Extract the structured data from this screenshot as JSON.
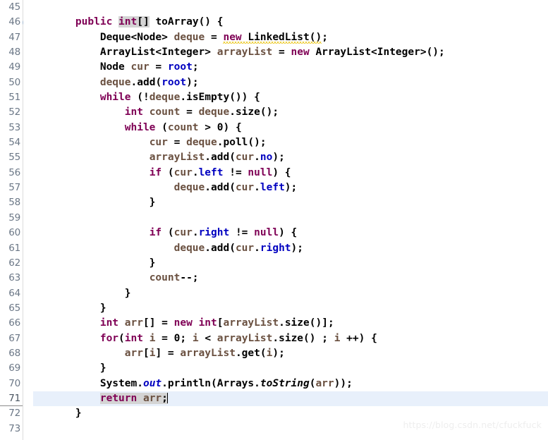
{
  "editor": {
    "language": "Java",
    "first_line": 45,
    "last_line": 73,
    "current_line": 71,
    "fold_marker_line": 46,
    "gutter": {
      "line_numbers": [
        "45",
        "46",
        "47",
        "48",
        "49",
        "50",
        "51",
        "52",
        "53",
        "54",
        "55",
        "56",
        "57",
        "58",
        "59",
        "60",
        "61",
        "62",
        "63",
        "64",
        "65",
        "66",
        "67",
        "68",
        "69",
        "70",
        "71",
        "72",
        "73"
      ],
      "fold_icon": "collapse-minus-icon"
    },
    "colors": {
      "background": "#ffffff",
      "keyword": "#7f0055",
      "field": "#0000c0",
      "local_variable": "#6a5040",
      "plain_text": "#000000",
      "line_number": "#6b7786",
      "current_line_highlight": "#e8f0fb",
      "occurrence_highlight": "#d4d4d4",
      "warning_squiggle": "#e8c000",
      "gutter_border": "#dcdcdc",
      "watermark": "#eeeeee"
    },
    "lines": [
      {
        "n": "45",
        "text": ""
      },
      {
        "n": "46",
        "text": "    public int[] toArray() {"
      },
      {
        "n": "47",
        "text": "        Deque<Node> deque = new LinkedList();"
      },
      {
        "n": "48",
        "text": "        ArrayList<Integer> arrayList = new ArrayList<Integer>();"
      },
      {
        "n": "49",
        "text": "        Node cur = root;"
      },
      {
        "n": "50",
        "text": "        deque.add(root);"
      },
      {
        "n": "51",
        "text": "        while (!deque.isEmpty()) {"
      },
      {
        "n": "52",
        "text": "            int count = deque.size();"
      },
      {
        "n": "53",
        "text": "            while (count > 0) {"
      },
      {
        "n": "54",
        "text": "                cur = deque.poll();"
      },
      {
        "n": "55",
        "text": "                arrayList.add(cur.no);"
      },
      {
        "n": "56",
        "text": "                if (cur.left != null) {"
      },
      {
        "n": "57",
        "text": "                    deque.add(cur.left);"
      },
      {
        "n": "58",
        "text": "                }"
      },
      {
        "n": "59",
        "text": ""
      },
      {
        "n": "60",
        "text": "                if (cur.right != null) {"
      },
      {
        "n": "61",
        "text": "                    deque.add(cur.right);"
      },
      {
        "n": "62",
        "text": "                }"
      },
      {
        "n": "63",
        "text": "                count--;"
      },
      {
        "n": "64",
        "text": "            }"
      },
      {
        "n": "65",
        "text": "        }"
      },
      {
        "n": "66",
        "text": "        int arr[] = new int[arrayList.size()];"
      },
      {
        "n": "67",
        "text": "        for(int i = 0; i < arrayList.size() ; i ++) {"
      },
      {
        "n": "68",
        "text": "            arr[i] = arrayList.get(i);"
      },
      {
        "n": "69",
        "text": "        }"
      },
      {
        "n": "70",
        "text": "        System.out.println(Arrays.toString(arr));"
      },
      {
        "n": "71",
        "text": "        return arr;"
      },
      {
        "n": "72",
        "text": "    }"
      },
      {
        "n": "73",
        "text": ""
      }
    ],
    "annotations": {
      "warning_line": 47,
      "warning_token": "new LinkedList()",
      "occurrence_tokens": [
        "int[]",
        "return arr;"
      ]
    }
  },
  "watermark": {
    "text": "https://blog.csdn.net/cfuckfuck"
  }
}
